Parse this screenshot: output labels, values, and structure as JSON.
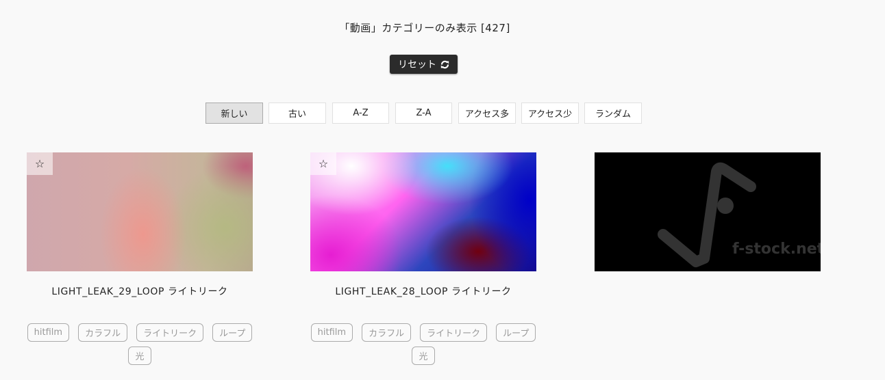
{
  "heading": "「動画」カテゴリーのみ表示 [427]",
  "reset": {
    "label": "リセット"
  },
  "sort": {
    "active_index": 0,
    "options": [
      "新しい",
      "古い",
      "A-Z",
      "Z-A",
      "アクセス多",
      "アクセス少",
      "ランダム"
    ]
  },
  "cards": [
    {
      "title": "LIGHT_LEAK_29_LOOP ライトリーク",
      "star": "☆",
      "tags": [
        "hitfilm",
        "カラフル",
        "ライトリーク",
        "ループ",
        "光"
      ]
    },
    {
      "title": "LIGHT_LEAK_28_LOOP ライトリーク",
      "star": "☆",
      "tags": [
        "hitfilm",
        "カラフル",
        "ライトリーク",
        "ループ",
        "光"
      ]
    },
    {
      "logo_text": "f-stock.net"
    }
  ],
  "colors": {
    "button_dark": "#2b2b2b",
    "active_sort_bg": "#e2e2e2",
    "tag_text": "#999999"
  }
}
